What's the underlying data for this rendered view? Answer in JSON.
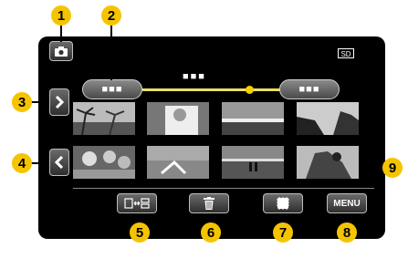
{
  "callouts": [
    "1",
    "2",
    "3",
    "4",
    "5",
    "6",
    "7",
    "8",
    "9"
  ],
  "screen": {
    "storage_badge": "SD",
    "date_label": "■■■",
    "prev_date_label": "■■■",
    "next_date_label": "■■■",
    "menu_label": "MENU"
  },
  "icons": {
    "mode": "camera-icon",
    "next": "chevron-right-icon",
    "prev": "chevron-left-icon",
    "switch": "display-switch-icon",
    "delete": "trash-icon",
    "select": "playback-select-icon"
  },
  "colors": {
    "callout": "#f5c400",
    "timeline": "#e8e060",
    "screen": "#000000"
  }
}
